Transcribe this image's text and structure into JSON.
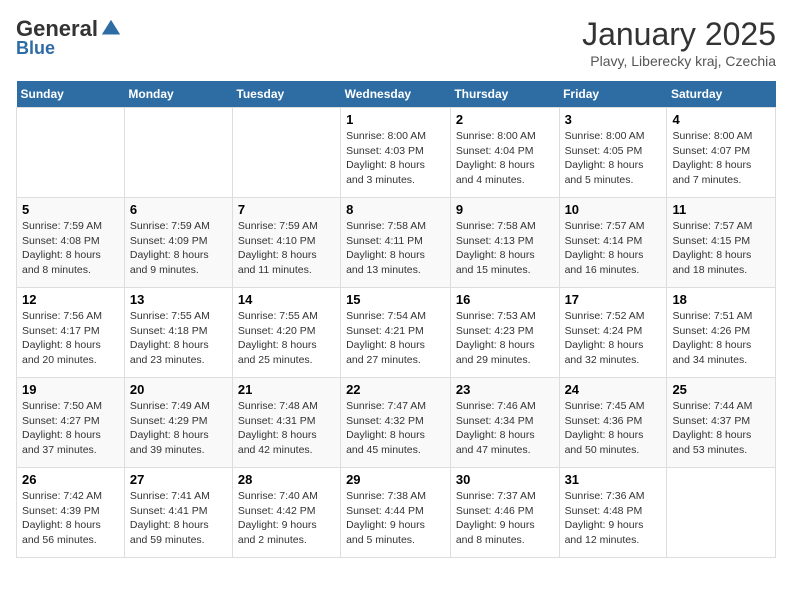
{
  "header": {
    "logo_general": "General",
    "logo_blue": "Blue",
    "month": "January 2025",
    "location": "Plavy, Liberecky kraj, Czechia"
  },
  "weekdays": [
    "Sunday",
    "Monday",
    "Tuesday",
    "Wednesday",
    "Thursday",
    "Friday",
    "Saturday"
  ],
  "weeks": [
    [
      {
        "day": "",
        "info": ""
      },
      {
        "day": "",
        "info": ""
      },
      {
        "day": "",
        "info": ""
      },
      {
        "day": "1",
        "info": "Sunrise: 8:00 AM\nSunset: 4:03 PM\nDaylight: 8 hours and 3 minutes."
      },
      {
        "day": "2",
        "info": "Sunrise: 8:00 AM\nSunset: 4:04 PM\nDaylight: 8 hours and 4 minutes."
      },
      {
        "day": "3",
        "info": "Sunrise: 8:00 AM\nSunset: 4:05 PM\nDaylight: 8 hours and 5 minutes."
      },
      {
        "day": "4",
        "info": "Sunrise: 8:00 AM\nSunset: 4:07 PM\nDaylight: 8 hours and 7 minutes."
      }
    ],
    [
      {
        "day": "5",
        "info": "Sunrise: 7:59 AM\nSunset: 4:08 PM\nDaylight: 8 hours and 8 minutes."
      },
      {
        "day": "6",
        "info": "Sunrise: 7:59 AM\nSunset: 4:09 PM\nDaylight: 8 hours and 9 minutes."
      },
      {
        "day": "7",
        "info": "Sunrise: 7:59 AM\nSunset: 4:10 PM\nDaylight: 8 hours and 11 minutes."
      },
      {
        "day": "8",
        "info": "Sunrise: 7:58 AM\nSunset: 4:11 PM\nDaylight: 8 hours and 13 minutes."
      },
      {
        "day": "9",
        "info": "Sunrise: 7:58 AM\nSunset: 4:13 PM\nDaylight: 8 hours and 15 minutes."
      },
      {
        "day": "10",
        "info": "Sunrise: 7:57 AM\nSunset: 4:14 PM\nDaylight: 8 hours and 16 minutes."
      },
      {
        "day": "11",
        "info": "Sunrise: 7:57 AM\nSunset: 4:15 PM\nDaylight: 8 hours and 18 minutes."
      }
    ],
    [
      {
        "day": "12",
        "info": "Sunrise: 7:56 AM\nSunset: 4:17 PM\nDaylight: 8 hours and 20 minutes."
      },
      {
        "day": "13",
        "info": "Sunrise: 7:55 AM\nSunset: 4:18 PM\nDaylight: 8 hours and 23 minutes."
      },
      {
        "day": "14",
        "info": "Sunrise: 7:55 AM\nSunset: 4:20 PM\nDaylight: 8 hours and 25 minutes."
      },
      {
        "day": "15",
        "info": "Sunrise: 7:54 AM\nSunset: 4:21 PM\nDaylight: 8 hours and 27 minutes."
      },
      {
        "day": "16",
        "info": "Sunrise: 7:53 AM\nSunset: 4:23 PM\nDaylight: 8 hours and 29 minutes."
      },
      {
        "day": "17",
        "info": "Sunrise: 7:52 AM\nSunset: 4:24 PM\nDaylight: 8 hours and 32 minutes."
      },
      {
        "day": "18",
        "info": "Sunrise: 7:51 AM\nSunset: 4:26 PM\nDaylight: 8 hours and 34 minutes."
      }
    ],
    [
      {
        "day": "19",
        "info": "Sunrise: 7:50 AM\nSunset: 4:27 PM\nDaylight: 8 hours and 37 minutes."
      },
      {
        "day": "20",
        "info": "Sunrise: 7:49 AM\nSunset: 4:29 PM\nDaylight: 8 hours and 39 minutes."
      },
      {
        "day": "21",
        "info": "Sunrise: 7:48 AM\nSunset: 4:31 PM\nDaylight: 8 hours and 42 minutes."
      },
      {
        "day": "22",
        "info": "Sunrise: 7:47 AM\nSunset: 4:32 PM\nDaylight: 8 hours and 45 minutes."
      },
      {
        "day": "23",
        "info": "Sunrise: 7:46 AM\nSunset: 4:34 PM\nDaylight: 8 hours and 47 minutes."
      },
      {
        "day": "24",
        "info": "Sunrise: 7:45 AM\nSunset: 4:36 PM\nDaylight: 8 hours and 50 minutes."
      },
      {
        "day": "25",
        "info": "Sunrise: 7:44 AM\nSunset: 4:37 PM\nDaylight: 8 hours and 53 minutes."
      }
    ],
    [
      {
        "day": "26",
        "info": "Sunrise: 7:42 AM\nSunset: 4:39 PM\nDaylight: 8 hours and 56 minutes."
      },
      {
        "day": "27",
        "info": "Sunrise: 7:41 AM\nSunset: 4:41 PM\nDaylight: 8 hours and 59 minutes."
      },
      {
        "day": "28",
        "info": "Sunrise: 7:40 AM\nSunset: 4:42 PM\nDaylight: 9 hours and 2 minutes."
      },
      {
        "day": "29",
        "info": "Sunrise: 7:38 AM\nSunset: 4:44 PM\nDaylight: 9 hours and 5 minutes."
      },
      {
        "day": "30",
        "info": "Sunrise: 7:37 AM\nSunset: 4:46 PM\nDaylight: 9 hours and 8 minutes."
      },
      {
        "day": "31",
        "info": "Sunrise: 7:36 AM\nSunset: 4:48 PM\nDaylight: 9 hours and 12 minutes."
      },
      {
        "day": "",
        "info": ""
      }
    ]
  ]
}
